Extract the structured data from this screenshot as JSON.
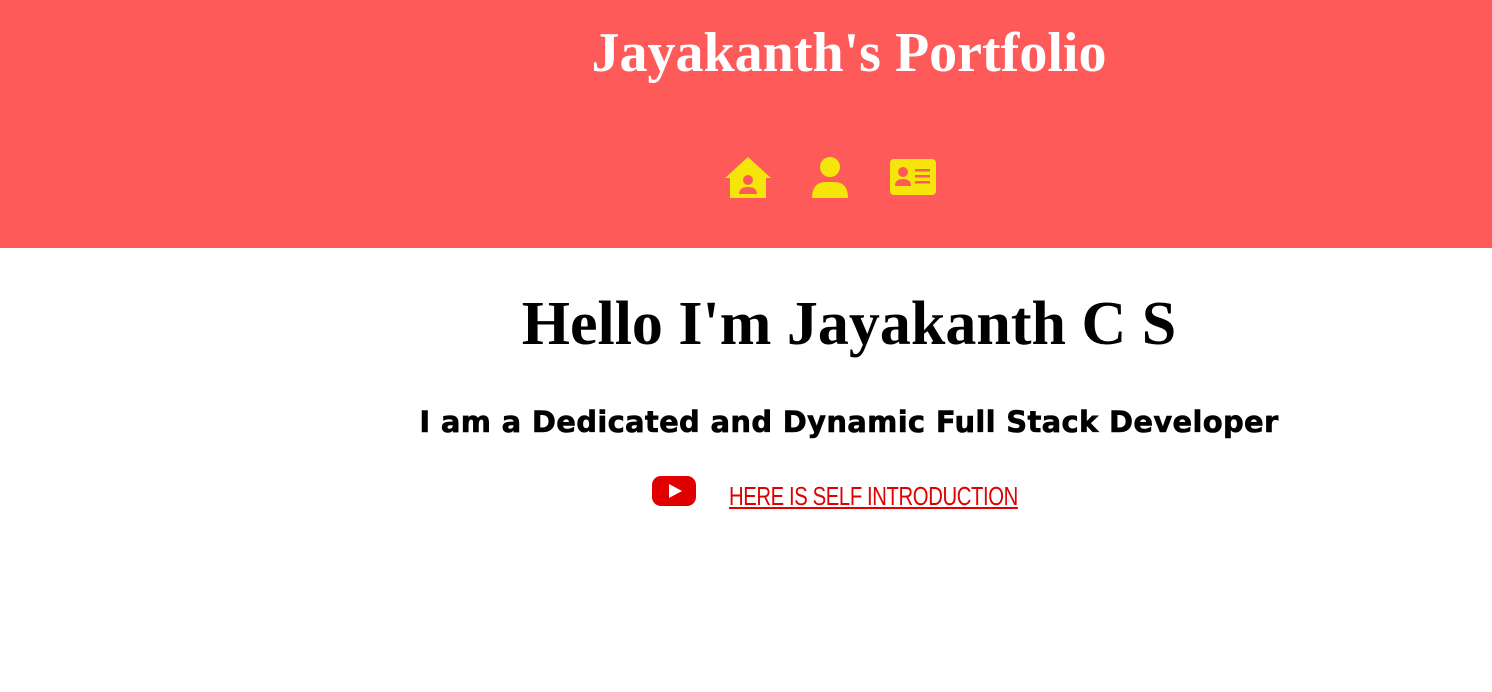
{
  "header": {
    "title": "Jayakanth's Portfolio",
    "background_color": "#ff5a5a",
    "nav": [
      {
        "icon": "house-user-icon",
        "color": "#f5e50a"
      },
      {
        "icon": "user-icon",
        "color": "#f5e50a"
      },
      {
        "icon": "address-card-icon",
        "color": "#f5e50a"
      }
    ]
  },
  "hero": {
    "heading": "Hello I'm Jayakanth C S",
    "subheading": "I am a Dedicated and Dynamic Full Stack Developer",
    "video_link": {
      "icon": "youtube-icon",
      "label": "HERE IS SELF INTRODUCTION",
      "color": "#e00000"
    }
  }
}
